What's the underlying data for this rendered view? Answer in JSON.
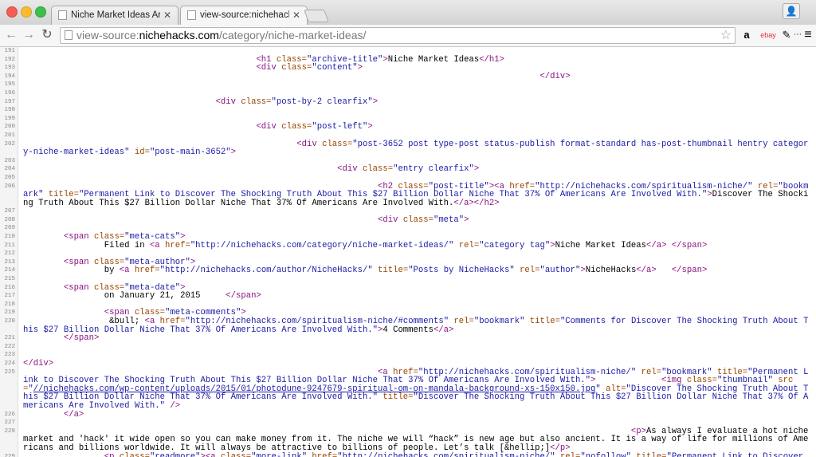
{
  "window": {
    "tabs": [
      {
        "label": "Niche Market Ideas Archive",
        "active": false
      },
      {
        "label": "view-source:nichehacks.co",
        "active": true
      }
    ]
  },
  "toolbar": {
    "back_icon": "←",
    "forward_icon": "→",
    "reload_icon": "↻",
    "url_prefix": "view-source:",
    "url_host": "nichehacks.com",
    "url_path": "/category/niche-market-ideas/",
    "star_icon": "☆",
    "extensions": [
      "a",
      "ebay",
      "✎",
      "⋯"
    ],
    "menu_icon": "≡"
  },
  "source_lines": [
    {
      "n": "191",
      "html": ""
    },
    {
      "n": "192",
      "html": "<span class=\"tag\">                                              &lt;h1 </span><span class=\"an\">class=</span><span class=\"av\">\"archive-title\"</span><span class=\"tag\">&gt;</span>Niche Market Ideas<span class=\"tag\">&lt;/h1&gt;</span>"
    },
    {
      "n": "193",
      "html": "<span class=\"tag\">                                              &lt;div </span><span class=\"an\">class=</span><span class=\"av\">\"content\"</span><span class=\"tag\">&gt;</span>"
    },
    {
      "n": "194",
      "html": "<span class=\"tag\">                                                                                                      &lt;/div&gt;</span>"
    },
    {
      "n": "195",
      "html": ""
    },
    {
      "n": "196",
      "html": ""
    },
    {
      "n": "197",
      "html": "<span class=\"tag\">                                      &lt;div </span><span class=\"an\">class=</span><span class=\"av\">\"post-by-2 clearfix\"</span><span class=\"tag\">&gt;</span>"
    },
    {
      "n": "198",
      "html": ""
    },
    {
      "n": "199",
      "html": ""
    },
    {
      "n": "200",
      "html": "<span class=\"tag\">                                              &lt;div </span><span class=\"an\">class=</span><span class=\"av\">\"post-left\"</span><span class=\"tag\">&gt;</span>"
    },
    {
      "n": "201",
      "html": ""
    },
    {
      "n": "202",
      "html": "<span class=\"tag\">                                                      &lt;div </span><span class=\"an\">class=</span><span class=\"av\">\"post-3652 post type-post status-publish format-standard has-post-thumbnail hentry category-niche-market-ideas\"</span> <span class=\"an\">id=</span><span class=\"av\">\"post-main-3652\"</span><span class=\"tag\">&gt;</span>"
    },
    {
      "n": "203",
      "html": ""
    },
    {
      "n": "204",
      "html": "<span class=\"tag\">                                                              &lt;div </span><span class=\"an\">class=</span><span class=\"av\">\"entry clearfix\"</span><span class=\"tag\">&gt;</span>"
    },
    {
      "n": "205",
      "html": ""
    },
    {
      "n": "206",
      "html": "<span class=\"tag\">                                                                      &lt;h2 </span><span class=\"an\">class=</span><span class=\"av\">\"post-title\"</span><span class=\"tag\">&gt;&lt;a </span><span class=\"an\">href=</span><span class=\"av\">\"http://nichehacks.com/spiritualism-niche/\"</span> <span class=\"an\">rel=</span><span class=\"av\">\"bookmark\"</span> <span class=\"an\">title=</span><span class=\"av\">\"Permanent Link to Discover The Shocking Truth About This $27 Billion Dollar Niche That 37% Of Americans Are Involved With.\"</span><span class=\"tag\">&gt;</span>Discover The Shocking Truth About This $27 Billion Dollar Niche That 37% Of Americans Are Involved With.<span class=\"tag\">&lt;/a&gt;&lt;/h2&gt;</span>"
    },
    {
      "n": "207",
      "html": ""
    },
    {
      "n": "208",
      "html": "<span class=\"tag\">                                                                      &lt;div </span><span class=\"an\">class=</span><span class=\"av\">\"meta\"</span><span class=\"tag\">&gt;</span>"
    },
    {
      "n": "209",
      "html": ""
    },
    {
      "n": "210",
      "html": "<span class=\"tag\">        &lt;span </span><span class=\"an\">class=</span><span class=\"av\">\"meta-cats\"</span><span class=\"tag\">&gt;</span>"
    },
    {
      "n": "211",
      "html": "                Filed in <span class=\"tag\">&lt;a </span><span class=\"an\">href=</span><span class=\"av\">\"http://nichehacks.com/category/niche-market-ideas/\"</span> <span class=\"an\">rel=</span><span class=\"av\">\"category tag\"</span><span class=\"tag\">&gt;</span>Niche Market Ideas<span class=\"tag\">&lt;/a&gt;</span> <span class=\"tag\">&lt;/span&gt;</span>"
    },
    {
      "n": "212",
      "html": ""
    },
    {
      "n": "213",
      "html": "<span class=\"tag\">        &lt;span </span><span class=\"an\">class=</span><span class=\"av\">\"meta-author\"</span><span class=\"tag\">&gt;</span>"
    },
    {
      "n": "214",
      "html": "                by <span class=\"tag\">&lt;a </span><span class=\"an\">href=</span><span class=\"av\">\"http://nichehacks.com/author/NicheHacks/\"</span> <span class=\"an\">title=</span><span class=\"av\">\"Posts by NicheHacks\"</span> <span class=\"an\">rel=</span><span class=\"av\">\"author\"</span><span class=\"tag\">&gt;</span>NicheHacks<span class=\"tag\">&lt;/a&gt;</span>   <span class=\"tag\">&lt;/span&gt;</span>"
    },
    {
      "n": "215",
      "html": ""
    },
    {
      "n": "216",
      "html": "<span class=\"tag\">        &lt;span </span><span class=\"an\">class=</span><span class=\"av\">\"meta-date\"</span><span class=\"tag\">&gt;</span>"
    },
    {
      "n": "217",
      "html": "                on January 21, 2015     <span class=\"tag\">&lt;/span&gt;</span>"
    },
    {
      "n": "218",
      "html": ""
    },
    {
      "n": "219",
      "html": "<span class=\"tag\">                &lt;span </span><span class=\"an\">class=</span><span class=\"av\">\"meta-comments\"</span><span class=\"tag\">&gt;</span>"
    },
    {
      "n": "220",
      "html": "                 &amp;bull; <span class=\"tag\">&lt;a </span><span class=\"an\">href=</span><span class=\"av\">\"http://nichehacks.com/spiritualism-niche/#comments\"</span> <span class=\"an\">rel=</span><span class=\"av\">\"bookmark\"</span> <span class=\"an\">title=</span><span class=\"av\">\"Comments for Discover The Shocking Truth About This $27 Billion Dollar Niche That 37% Of Americans Are Involved With.\"</span><span class=\"tag\">&gt;</span>4 Comments<span class=\"tag\">&lt;/a&gt;</span>"
    },
    {
      "n": "221",
      "html": "<span class=\"tag\">        &lt;/span&gt;</span>"
    },
    {
      "n": "222",
      "html": ""
    },
    {
      "n": "223",
      "html": ""
    },
    {
      "n": "224",
      "html": "<span class=\"tag\">&lt;/div&gt;</span>"
    },
    {
      "n": "225",
      "html": "<span class=\"tag\">                                                                      &lt;a </span><span class=\"an\">href=</span><span class=\"av\">\"http://nichehacks.com/spiritualism-niche/\"</span> <span class=\"an\">rel=</span><span class=\"av\">\"bookmark\"</span> <span class=\"an\">title=</span><span class=\"av\">\"Permanent Link to Discover The Shocking Truth About This $27 Billion Dollar Niche That 37% Of Americans Are Involved With.\"</span><span class=\"tag\">&gt;</span>             <span class=\"tag\">&lt;img </span><span class=\"an\">class=</span><span class=\"av\">\"thumbnail\"</span> <span class=\"an\">src=</span><span class=\"av\">\"</span><span class=\"lk\">//nichehacks.com/wp-content/uploads/2015/01/photodune-9247679-spiritual-om-on-mandala-background-xs-150x150.jpg</span><span class=\"av\">\"</span> <span class=\"an\">alt=</span><span class=\"av\">\"Discover The Shocking Truth About This $27 Billion Dollar Niche That 37% Of Americans Are Involved With.\"</span> <span class=\"an\">title=</span><span class=\"av\">\"Discover The Shocking Truth About This $27 Billion Dollar Niche That 37% Of Americans Are Involved With.\"</span> <span class=\"tag\">/&gt;</span>"
    },
    {
      "n": "226",
      "html": "<span class=\"tag\">        &lt;/a&gt;</span>"
    },
    {
      "n": "227",
      "html": ""
    },
    {
      "n": "228",
      "html": "<span class=\"tag\">                                                                                                                        &lt;p&gt;</span>As always I evaluate a hot niche market and 'hack' it wide open so you can make money from it. The niche we will “hack” is new age but also ancient. It is a way of life for millions of Americans and billions worldwide. It will always be attractive to billions of people. Let’s talk [&amp;hellip;]<span class=\"tag\">&lt;/p&gt;</span>"
    },
    {
      "n": "229",
      "html": "<span class=\"tag\">                &lt;p </span><span class=\"an\">class=</span><span class=\"av\">\"readmore\"</span><span class=\"tag\">&gt;&lt;a </span><span class=\"an\">class=</span><span class=\"av\">\"more-link\"</span> <span class=\"an\">href=</span><span class=\"av\">\"http://nichehacks.com/spiritualism-niche/\"</span> <span class=\"an\">rel=</span><span class=\"av\">\"nofollow\"</span> <span class=\"an\">title=</span><span class=\"av\">\"Permanent Link to Discover</span>"
    }
  ]
}
